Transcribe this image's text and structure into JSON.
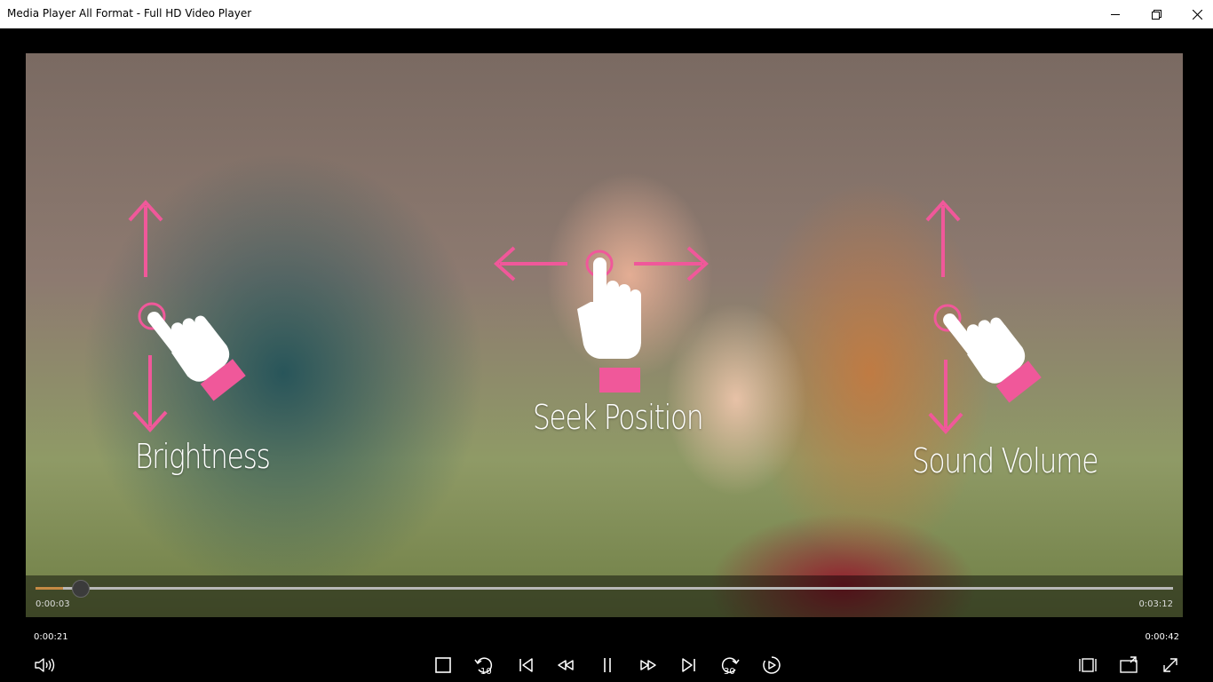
{
  "window": {
    "title": "Media Player All Format - Full HD Video Player"
  },
  "window_controls": {
    "minimize_icon": "minimize-icon",
    "restore_icon": "restore-icon",
    "close_icon": "close-icon"
  },
  "gestures": {
    "brightness_label": "Brightness",
    "seek_label": "Seek Position",
    "volume_label": "Sound Volume",
    "accent_color": "#f0589a"
  },
  "seekbar": {
    "elapsed": "0:00:03",
    "total": "0:03:12",
    "progress_percent": 2.4,
    "fill_color": "#c58a44"
  },
  "clocks": {
    "left": "0:00:21",
    "right": "0:00:42"
  },
  "controls": {
    "left": [
      "volume-icon"
    ],
    "center": [
      "stop-icon",
      "rewind-10-icon",
      "previous-icon",
      "fast-rewind-icon",
      "pause-icon",
      "fast-forward-icon",
      "next-icon",
      "forward-30-icon",
      "playback-speed-icon"
    ],
    "right": [
      "aspect-ratio-icon",
      "mini-view-icon",
      "fullscreen-icon"
    ],
    "rewind_label": "10",
    "forward_label": "30"
  }
}
